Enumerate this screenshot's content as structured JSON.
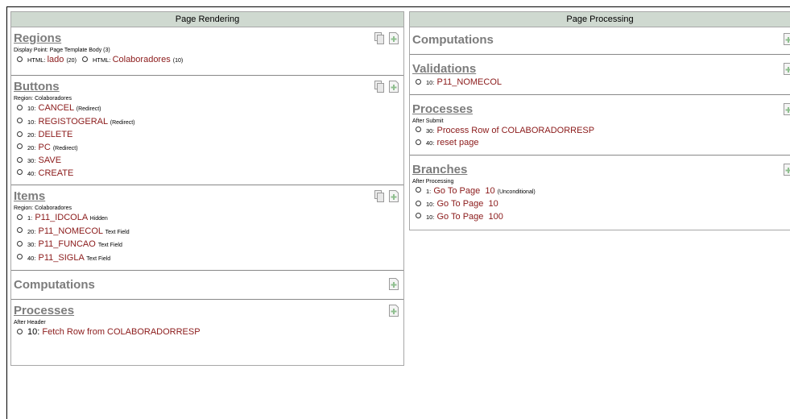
{
  "rendering": {
    "header": "Page Rendering",
    "regions": {
      "title": "Regions",
      "sub": "Display Point: Page Template Body (3)",
      "items": [
        {
          "type": "HTML",
          "name": "lado",
          "note": "(20)"
        },
        {
          "type": "HTML",
          "name": "Colaboradores",
          "note": "(10)"
        }
      ]
    },
    "buttons": {
      "title": "Buttons",
      "sub": "Region: Colaboradores",
      "items": [
        {
          "seq": "10:",
          "name": "CANCEL",
          "note": "(Redirect)"
        },
        {
          "seq": "10:",
          "name": "REGISTOGERAL",
          "note": "(Redirect)"
        },
        {
          "seq": "20:",
          "name": "DELETE",
          "note": ""
        },
        {
          "seq": "20:",
          "name": "PC",
          "note": "(Redirect)"
        },
        {
          "seq": "30:",
          "name": "SAVE",
          "note": ""
        },
        {
          "seq": "40:",
          "name": "CREATE",
          "note": ""
        }
      ]
    },
    "items": {
      "title": "Items",
      "sub": "Region: Colaboradores",
      "items": [
        {
          "seq": "1:",
          "name": "P11_IDCOLA",
          "note": "Hidden"
        },
        {
          "seq": "20:",
          "name": "P11_NOMECOL",
          "note": "Text Field"
        },
        {
          "seq": "30:",
          "name": "P11_FUNCAO",
          "note": "Text Field"
        },
        {
          "seq": "40:",
          "name": "P11_SIGLA",
          "note": "Text Field"
        }
      ]
    },
    "computations": {
      "title": "Computations"
    },
    "processes": {
      "title": "Processes",
      "sub": "After Header",
      "items": [
        {
          "seq": "10:",
          "name": "Fetch Row from COLABORADORRESP"
        }
      ]
    }
  },
  "processing": {
    "header": "Page Processing",
    "computations": {
      "title": "Computations"
    },
    "validations": {
      "title": "Validations",
      "items": [
        {
          "seq": "10:",
          "name": "P11_NOMECOL"
        }
      ]
    },
    "processes": {
      "title": "Processes",
      "sub": "After Submit",
      "items": [
        {
          "seq": "30:",
          "name": "Process Row of COLABORADORRESP"
        },
        {
          "seq": "40:",
          "name": "reset page"
        }
      ]
    },
    "branches": {
      "title": "Branches",
      "sub": "After Processing",
      "items": [
        {
          "seq": "1:",
          "name": "Go To Page  10",
          "note": "(Unconditional)"
        },
        {
          "seq": "10:",
          "name": "Go To Page  10",
          "note": ""
        },
        {
          "seq": "10:",
          "name": "Go To Page  100",
          "note": ""
        }
      ]
    }
  },
  "icons": {
    "copy": "copy-icon",
    "add": "add-icon"
  },
  "colors": {
    "header_bg": "#cfd9d0",
    "link": "#8b1a1a",
    "section_title": "#7c7c7c"
  }
}
